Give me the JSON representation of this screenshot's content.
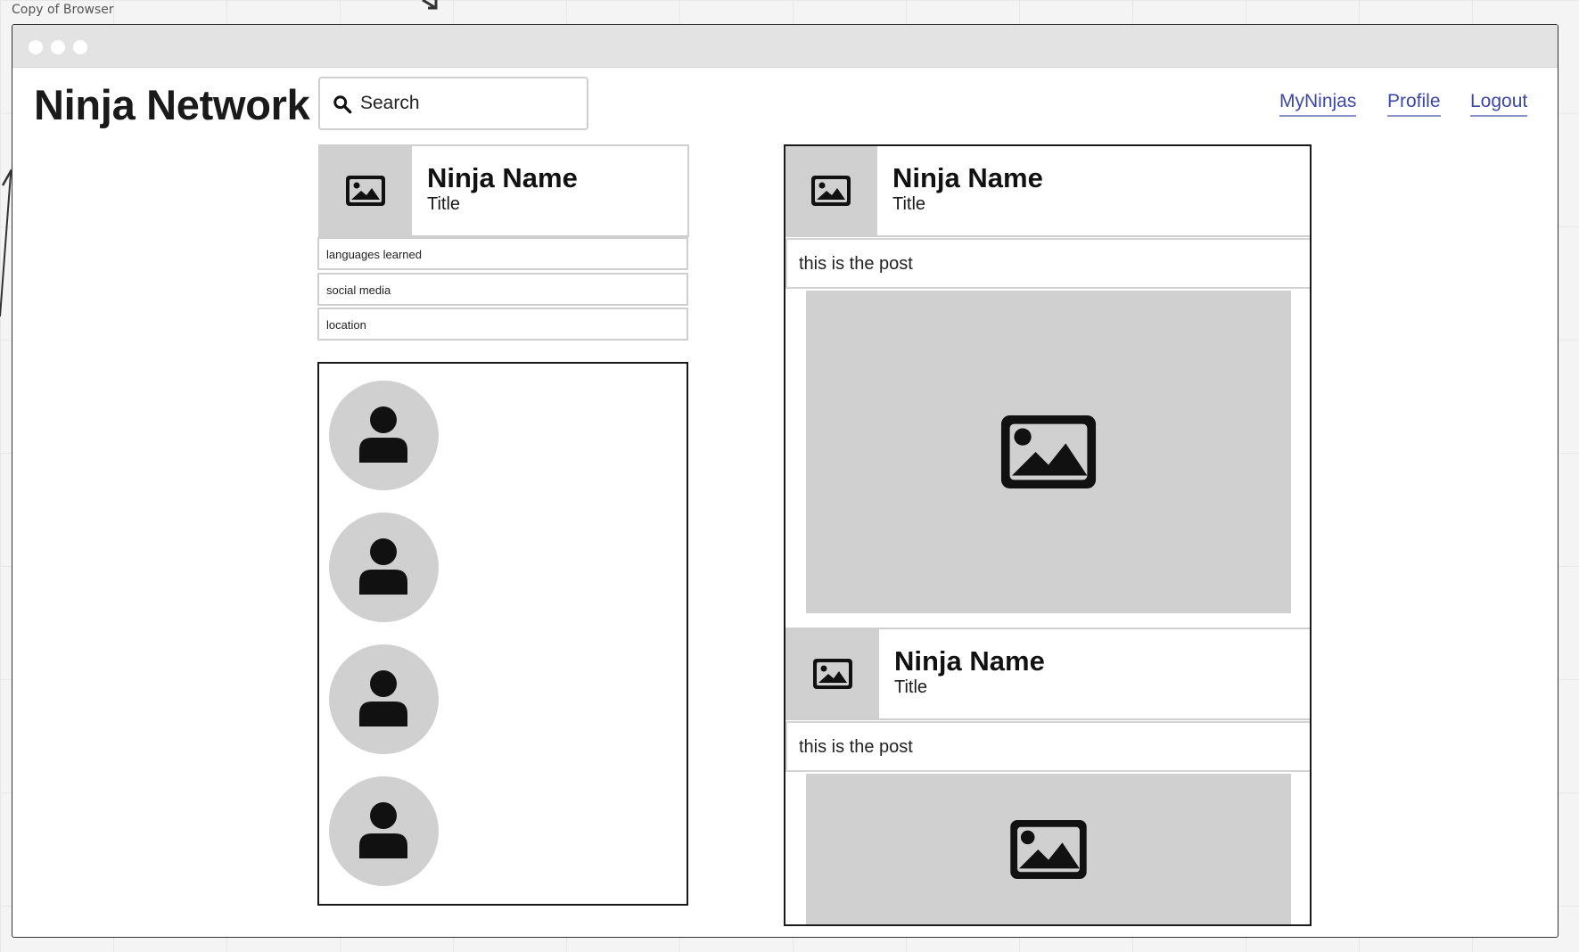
{
  "canvas": {
    "label": "Copy of Browser"
  },
  "header": {
    "brand": "Ninja Network",
    "search_placeholder": "Search",
    "nav": [
      {
        "label": "MyNinjas"
      },
      {
        "label": "Profile"
      },
      {
        "label": "Logout"
      }
    ]
  },
  "profile": {
    "name": "Ninja Name",
    "title": "Title",
    "details": [
      {
        "label": "languages learned"
      },
      {
        "label": "social media"
      },
      {
        "label": "location"
      }
    ]
  },
  "friends": {
    "count": 4
  },
  "feed": {
    "posts": [
      {
        "author": "Ninja Name",
        "title": "Title",
        "text": "this is the post"
      },
      {
        "author": "Ninja Name",
        "title": "Title",
        "text": "this is the post"
      }
    ]
  },
  "colors": {
    "link": "#3b46b0",
    "placeholder_gray": "#d0d0d0",
    "titlebar": "#e3e3e3"
  },
  "icons": {
    "search": "search-icon",
    "image": "image-placeholder-icon",
    "user": "user-avatar-icon"
  }
}
